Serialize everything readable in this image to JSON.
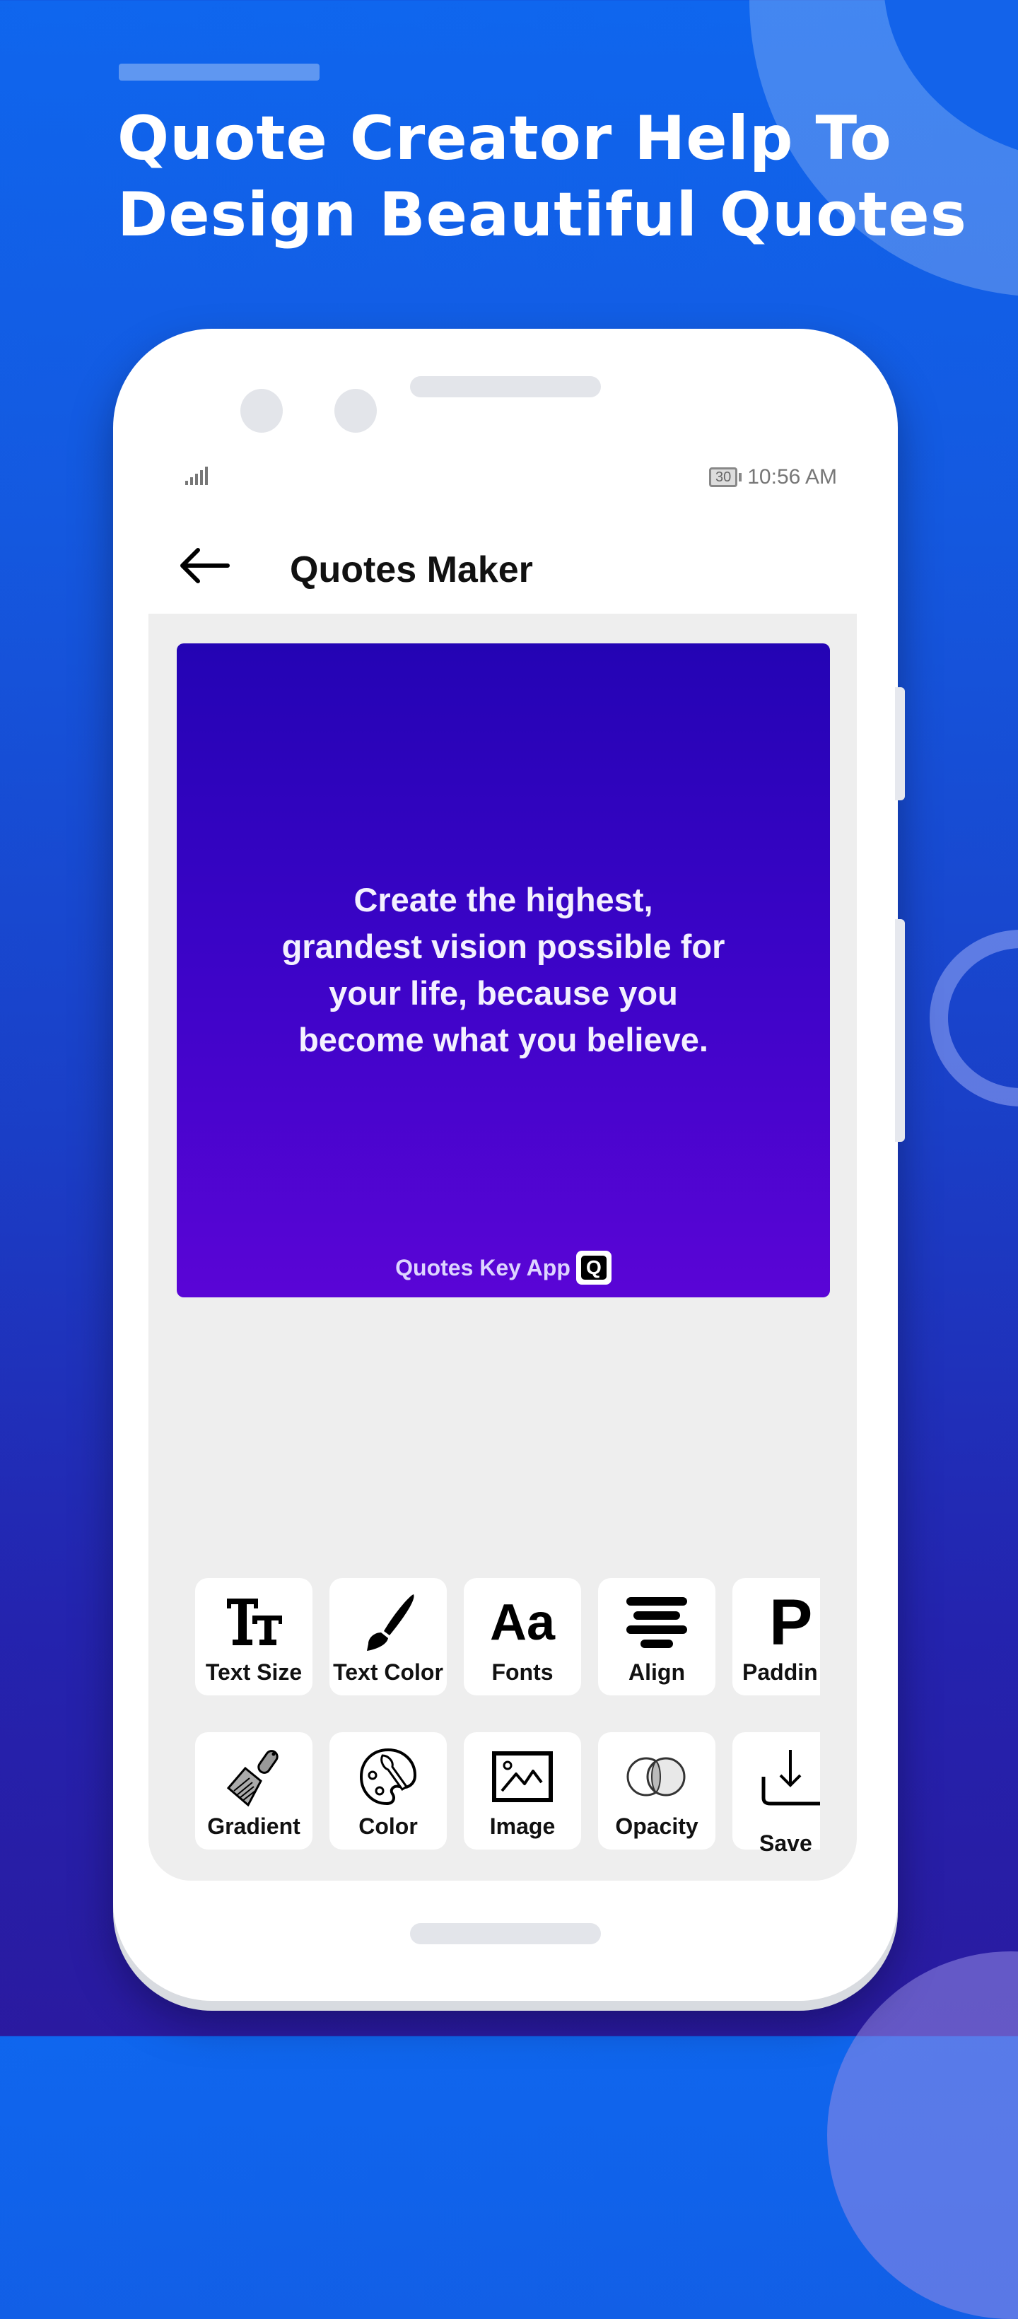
{
  "headline": {
    "lines": [
      "Quote Creator Help To",
      "Design Beautiful Quotes"
    ]
  },
  "status_bar": {
    "battery_level": "30",
    "time": "10:56 AM",
    "signal_icon": "signal-bars-icon"
  },
  "app_bar": {
    "back_icon": "arrow-left-icon",
    "title": "Quotes Maker"
  },
  "quote_card": {
    "gradient_colors": [
      "#2404b4",
      "#5a05d6"
    ],
    "lines": [
      "Create the highest,",
      "grandest vision possible for",
      "your life, because you",
      "become what you believe."
    ],
    "watermark": "Quotes Key App",
    "watermark_logo": "Q"
  },
  "tools": {
    "row1": [
      {
        "label": "Text Size",
        "icon": "text-size-icon"
      },
      {
        "label": "Text Color",
        "icon": "paint-brush-icon"
      },
      {
        "label": "Fonts",
        "icon": "font-aa-icon"
      },
      {
        "label": "Align",
        "icon": "align-center-icon"
      },
      {
        "label": "Paddin",
        "icon": "padding-p-icon"
      }
    ],
    "row2": [
      {
        "label": "Gradient",
        "icon": "gradient-brush-icon"
      },
      {
        "label": "Color",
        "icon": "palette-icon"
      },
      {
        "label": "Image",
        "icon": "image-icon"
      },
      {
        "label": "Opacity",
        "icon": "opacity-circles-icon"
      },
      {
        "label": "Save",
        "icon": "download-icon"
      }
    ]
  },
  "colors": {
    "background_top": "#0f66ee",
    "background_bottom": "#2a1aa0",
    "panel": "#eeeeee"
  }
}
